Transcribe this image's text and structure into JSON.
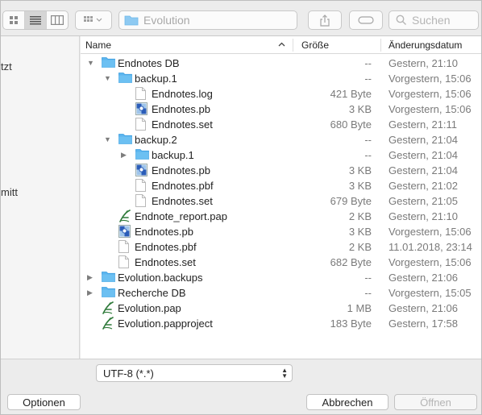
{
  "toolbar": {
    "path_folder": "Evolution",
    "search_placeholder": "Suchen"
  },
  "sidebar": {
    "fragments": [
      "tzt",
      "mitt"
    ]
  },
  "columns": {
    "name": "Name",
    "size": "Größe",
    "date": "Änderungsdatum"
  },
  "rows": [
    {
      "name": "Endnotes DB",
      "size": "--",
      "date": "Gestern, 21:10"
    },
    {
      "name": "backup.1",
      "size": "--",
      "date": "Vorgestern, 15:06"
    },
    {
      "name": "Endnotes.log",
      "size": "421 Byte",
      "date": "Vorgestern, 15:06"
    },
    {
      "name": "Endnotes.pb",
      "size": "3 KB",
      "date": "Vorgestern, 15:06"
    },
    {
      "name": "Endnotes.set",
      "size": "680 Byte",
      "date": "Gestern, 21:11"
    },
    {
      "name": "backup.2",
      "size": "--",
      "date": "Gestern, 21:04"
    },
    {
      "name": "backup.1",
      "size": "--",
      "date": "Gestern, 21:04"
    },
    {
      "name": "Endnotes.pb",
      "size": "3 KB",
      "date": "Gestern, 21:04"
    },
    {
      "name": "Endnotes.pbf",
      "size": "3 KB",
      "date": "Gestern, 21:02"
    },
    {
      "name": "Endnotes.set",
      "size": "679 Byte",
      "date": "Gestern, 21:05"
    },
    {
      "name": "Endnote_report.pap",
      "size": "2 KB",
      "date": "Gestern, 21:10"
    },
    {
      "name": "Endnotes.pb",
      "size": "3 KB",
      "date": "Vorgestern, 15:06"
    },
    {
      "name": "Endnotes.pbf",
      "size": "2 KB",
      "date": "11.01.2018, 23:14"
    },
    {
      "name": "Endnotes.set",
      "size": "682 Byte",
      "date": "Vorgestern, 15:06"
    },
    {
      "name": "Evolution.backups",
      "size": "--",
      "date": "Gestern, 21:06"
    },
    {
      "name": "Recherche DB",
      "size": "--",
      "date": "Vorgestern, 15:05"
    },
    {
      "name": "Evolution.pap",
      "size": "1 MB",
      "date": "Gestern, 21:06"
    },
    {
      "name": "Evolution.papproject",
      "size": "183 Byte",
      "date": "Gestern, 17:58"
    }
  ],
  "encoding": {
    "selected": "UTF-8 (*.*)"
  },
  "buttons": {
    "options": "Optionen",
    "cancel": "Abbrechen",
    "open": "Öffnen"
  },
  "colors": {
    "folder": "#5bb5ef",
    "folder_dark": "#3d9ee0",
    "app_green": "#2f7a3a"
  }
}
